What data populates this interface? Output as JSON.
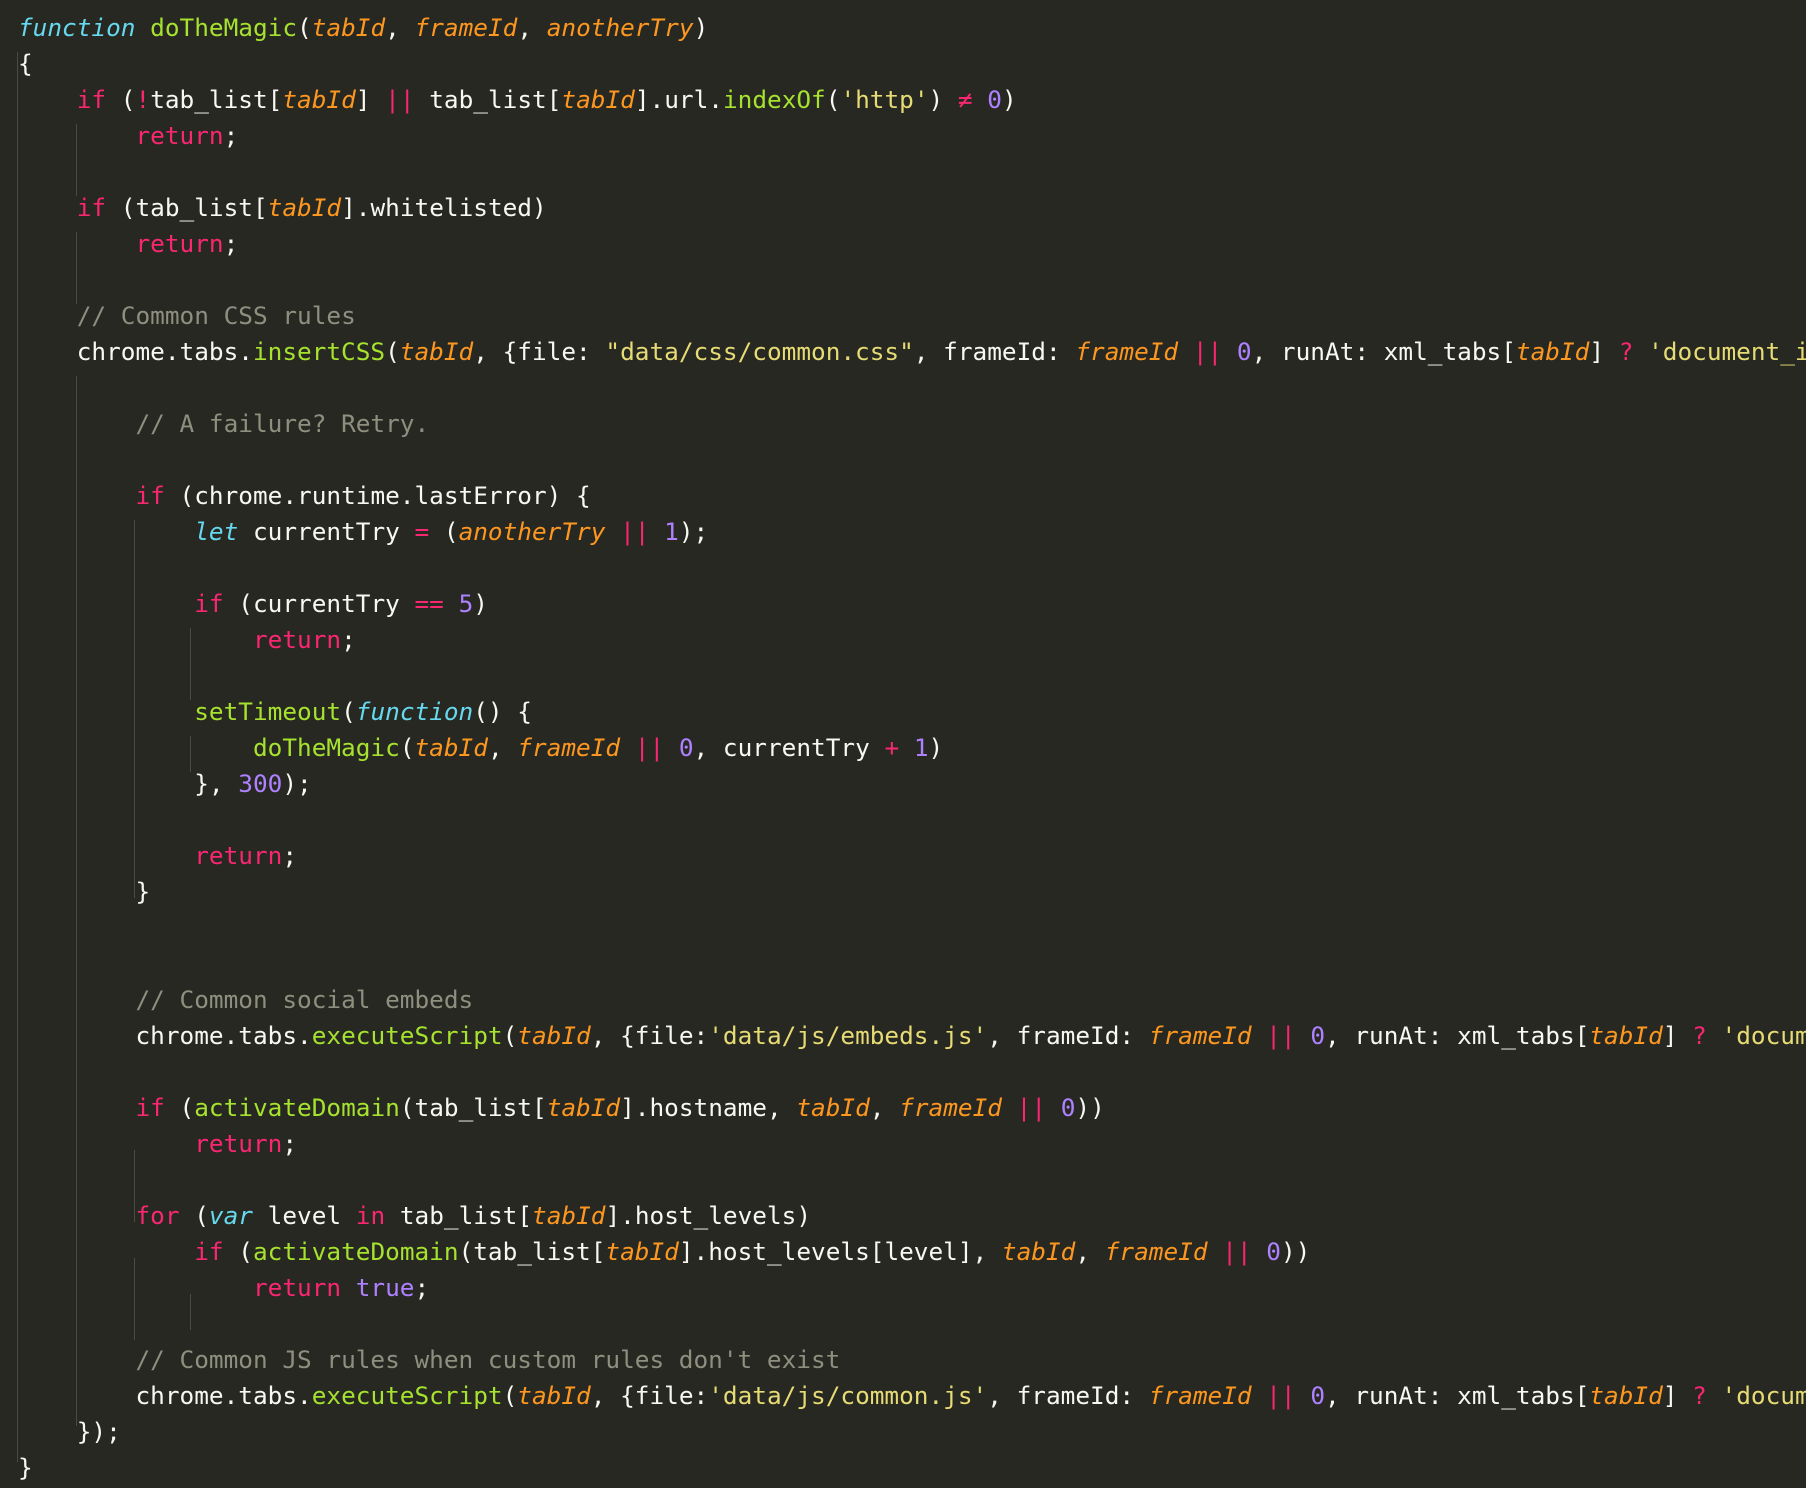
{
  "editor": {
    "theme": {
      "background": "#272822",
      "keyword": "#f92672",
      "storage": "#66d9ef",
      "function": "#a6e22e",
      "parameter": "#fd971f",
      "string": "#e6db74",
      "number": "#ae81ff",
      "comment": "#8f8f80",
      "plain": "#f8f8f2"
    },
    "lines": [
      [
        [
          "sto",
          "function"
        ],
        [
          "pl",
          " "
        ],
        [
          "fn",
          "doTheMagic"
        ],
        [
          "pl",
          "("
        ],
        [
          "param",
          "tabId"
        ],
        [
          "pl",
          ", "
        ],
        [
          "param",
          "frameId"
        ],
        [
          "pl",
          ", "
        ],
        [
          "param",
          "anotherTry"
        ],
        [
          "pl",
          ")"
        ]
      ],
      [
        [
          "pl",
          "{"
        ]
      ],
      [
        [
          "pl",
          "    "
        ],
        [
          "kw",
          "if"
        ],
        [
          "pl",
          " ("
        ],
        [
          "op",
          "!"
        ],
        [
          "pl",
          "tab_list["
        ],
        [
          "param",
          "tabId"
        ],
        [
          "pl",
          "] "
        ],
        [
          "op",
          "||"
        ],
        [
          "pl",
          " tab_list["
        ],
        [
          "param",
          "tabId"
        ],
        [
          "pl",
          "].url."
        ],
        [
          "fn",
          "indexOf"
        ],
        [
          "pl",
          "("
        ],
        [
          "str",
          "'http'"
        ],
        [
          "pl",
          ") "
        ],
        [
          "op",
          "≠"
        ],
        [
          "pl",
          " "
        ],
        [
          "num",
          "0"
        ],
        [
          "pl",
          ")"
        ]
      ],
      [
        [
          "pl",
          "        "
        ],
        [
          "kw",
          "return"
        ],
        [
          "pl",
          ";"
        ]
      ],
      [],
      [
        [
          "pl",
          "    "
        ],
        [
          "kw",
          "if"
        ],
        [
          "pl",
          " (tab_list["
        ],
        [
          "param",
          "tabId"
        ],
        [
          "pl",
          "].whitelisted)"
        ]
      ],
      [
        [
          "pl",
          "        "
        ],
        [
          "kw",
          "return"
        ],
        [
          "pl",
          ";"
        ]
      ],
      [],
      [
        [
          "pl",
          "    "
        ],
        [
          "cm",
          "// Common CSS rules"
        ]
      ],
      [
        [
          "pl",
          "    chrome.tabs."
        ],
        [
          "fn",
          "insertCSS"
        ],
        [
          "pl",
          "("
        ],
        [
          "param",
          "tabId"
        ],
        [
          "pl",
          ", {file: "
        ],
        [
          "str",
          "\"data/css/common.css\""
        ],
        [
          "pl",
          ", frameId: "
        ],
        [
          "param",
          "frameId"
        ],
        [
          "pl",
          " "
        ],
        [
          "op",
          "||"
        ],
        [
          "pl",
          " "
        ],
        [
          "num",
          "0"
        ],
        [
          "pl",
          ", runAt: xml_tabs["
        ],
        [
          "param",
          "tabId"
        ],
        [
          "pl",
          "] "
        ],
        [
          "op",
          "?"
        ],
        [
          "pl",
          " "
        ],
        [
          "str",
          "'document_idl"
        ]
      ],
      [],
      [
        [
          "pl",
          "        "
        ],
        [
          "cm",
          "// A failure? Retry."
        ]
      ],
      [],
      [
        [
          "pl",
          "        "
        ],
        [
          "kw",
          "if"
        ],
        [
          "pl",
          " (chrome.runtime.lastError) {"
        ]
      ],
      [
        [
          "pl",
          "            "
        ],
        [
          "sto",
          "let"
        ],
        [
          "pl",
          " currentTry "
        ],
        [
          "op",
          "="
        ],
        [
          "pl",
          " ("
        ],
        [
          "param",
          "anotherTry"
        ],
        [
          "pl",
          " "
        ],
        [
          "op",
          "||"
        ],
        [
          "pl",
          " "
        ],
        [
          "num",
          "1"
        ],
        [
          "pl",
          ");"
        ]
      ],
      [],
      [
        [
          "pl",
          "            "
        ],
        [
          "kw",
          "if"
        ],
        [
          "pl",
          " (currentTry "
        ],
        [
          "op",
          "=="
        ],
        [
          "pl",
          " "
        ],
        [
          "num",
          "5"
        ],
        [
          "pl",
          ")"
        ]
      ],
      [
        [
          "pl",
          "                "
        ],
        [
          "kw",
          "return"
        ],
        [
          "pl",
          ";"
        ]
      ],
      [],
      [
        [
          "pl",
          "            "
        ],
        [
          "fn",
          "setTimeout"
        ],
        [
          "pl",
          "("
        ],
        [
          "sto",
          "function"
        ],
        [
          "pl",
          "() {"
        ]
      ],
      [
        [
          "pl",
          "                "
        ],
        [
          "fn",
          "doTheMagic"
        ],
        [
          "pl",
          "("
        ],
        [
          "param",
          "tabId"
        ],
        [
          "pl",
          ", "
        ],
        [
          "param",
          "frameId"
        ],
        [
          "pl",
          " "
        ],
        [
          "op",
          "||"
        ],
        [
          "pl",
          " "
        ],
        [
          "num",
          "0"
        ],
        [
          "pl",
          ", currentTry "
        ],
        [
          "op",
          "+"
        ],
        [
          "pl",
          " "
        ],
        [
          "num",
          "1"
        ],
        [
          "pl",
          ")"
        ]
      ],
      [
        [
          "pl",
          "            }, "
        ],
        [
          "num",
          "300"
        ],
        [
          "pl",
          ");"
        ]
      ],
      [],
      [
        [
          "pl",
          "            "
        ],
        [
          "kw",
          "return"
        ],
        [
          "pl",
          ";"
        ]
      ],
      [
        [
          "pl",
          "        }"
        ]
      ],
      [],
      [],
      [
        [
          "pl",
          "        "
        ],
        [
          "cm",
          "// Common social embeds"
        ]
      ],
      [
        [
          "pl",
          "        chrome.tabs."
        ],
        [
          "fn",
          "executeScript"
        ],
        [
          "pl",
          "("
        ],
        [
          "param",
          "tabId"
        ],
        [
          "pl",
          ", {file:"
        ],
        [
          "str",
          "'data/js/embeds.js'"
        ],
        [
          "pl",
          ", frameId: "
        ],
        [
          "param",
          "frameId"
        ],
        [
          "pl",
          " "
        ],
        [
          "op",
          "||"
        ],
        [
          "pl",
          " "
        ],
        [
          "num",
          "0"
        ],
        [
          "pl",
          ", runAt: xml_tabs["
        ],
        [
          "param",
          "tabId"
        ],
        [
          "pl",
          "] "
        ],
        [
          "op",
          "?"
        ],
        [
          "pl",
          " "
        ],
        [
          "str",
          "'document"
        ]
      ],
      [],
      [
        [
          "pl",
          "        "
        ],
        [
          "kw",
          "if"
        ],
        [
          "pl",
          " ("
        ],
        [
          "fn",
          "activateDomain"
        ],
        [
          "pl",
          "(tab_list["
        ],
        [
          "param",
          "tabId"
        ],
        [
          "pl",
          "].hostname, "
        ],
        [
          "param",
          "tabId"
        ],
        [
          "pl",
          ", "
        ],
        [
          "param",
          "frameId"
        ],
        [
          "pl",
          " "
        ],
        [
          "op",
          "||"
        ],
        [
          "pl",
          " "
        ],
        [
          "num",
          "0"
        ],
        [
          "pl",
          "))"
        ]
      ],
      [
        [
          "pl",
          "            "
        ],
        [
          "kw",
          "return"
        ],
        [
          "pl",
          ";"
        ]
      ],
      [],
      [
        [
          "pl",
          "        "
        ],
        [
          "kw",
          "for"
        ],
        [
          "pl",
          " ("
        ],
        [
          "sto",
          "var"
        ],
        [
          "pl",
          " level "
        ],
        [
          "kw",
          "in"
        ],
        [
          "pl",
          " tab_list["
        ],
        [
          "param",
          "tabId"
        ],
        [
          "pl",
          "].host_levels)"
        ]
      ],
      [
        [
          "pl",
          "            "
        ],
        [
          "kw",
          "if"
        ],
        [
          "pl",
          " ("
        ],
        [
          "fn",
          "activateDomain"
        ],
        [
          "pl",
          "(tab_list["
        ],
        [
          "param",
          "tabId"
        ],
        [
          "pl",
          "].host_levels[level], "
        ],
        [
          "param",
          "tabId"
        ],
        [
          "pl",
          ", "
        ],
        [
          "param",
          "frameId"
        ],
        [
          "pl",
          " "
        ],
        [
          "op",
          "||"
        ],
        [
          "pl",
          " "
        ],
        [
          "num",
          "0"
        ],
        [
          "pl",
          "))"
        ]
      ],
      [
        [
          "pl",
          "                "
        ],
        [
          "kw",
          "return"
        ],
        [
          "pl",
          " "
        ],
        [
          "num",
          "true"
        ],
        [
          "pl",
          ";"
        ]
      ],
      [],
      [
        [
          "pl",
          "        "
        ],
        [
          "cm",
          "// Common JS rules when custom rules don't exist"
        ]
      ],
      [
        [
          "pl",
          "        chrome.tabs."
        ],
        [
          "fn",
          "executeScript"
        ],
        [
          "pl",
          "("
        ],
        [
          "param",
          "tabId"
        ],
        [
          "pl",
          ", {file:"
        ],
        [
          "str",
          "'data/js/common.js'"
        ],
        [
          "pl",
          ", frameId: "
        ],
        [
          "param",
          "frameId"
        ],
        [
          "pl",
          " "
        ],
        [
          "op",
          "||"
        ],
        [
          "pl",
          " "
        ],
        [
          "num",
          "0"
        ],
        [
          "pl",
          ", runAt: xml_tabs["
        ],
        [
          "param",
          "tabId"
        ],
        [
          "pl",
          "] "
        ],
        [
          "op",
          "?"
        ],
        [
          "pl",
          " "
        ],
        [
          "str",
          "'document"
        ]
      ],
      [
        [
          "pl",
          "    });"
        ]
      ],
      [
        [
          "pl",
          "}"
        ]
      ]
    ]
  }
}
